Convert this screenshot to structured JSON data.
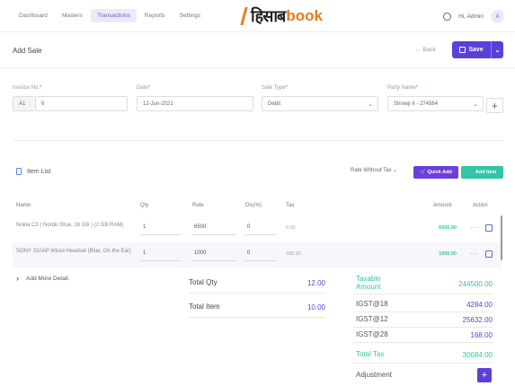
{
  "nav": {
    "items": [
      {
        "label": "Dashboard"
      },
      {
        "label": "Masters"
      },
      {
        "label": "Transactions"
      },
      {
        "label": "Reports"
      },
      {
        "label": "Settings"
      }
    ],
    "active_index": 2
  },
  "logo": {
    "hindi": "हिसाब",
    "book": "book"
  },
  "user": {
    "greeting": "Hi,",
    "name": "Admin",
    "initial": "A"
  },
  "page": {
    "title": "Add Sale",
    "back_label": "Back",
    "save_label": "Save"
  },
  "form": {
    "invoice": {
      "label": "Invoice No.",
      "prefix": "A1",
      "number": "6"
    },
    "date": {
      "label": "Date",
      "value": "12-Jun-2021"
    },
    "sale_type": {
      "label": "Sale Type",
      "value": "Debit"
    },
    "party": {
      "label": "Party Name",
      "value": "Shreeji II - 274564"
    }
  },
  "items": {
    "title": "Item List",
    "rate_mode": "Rate Without Tax",
    "quick_add_label": "Quick Add",
    "add_item_label": "Add Item",
    "columns": [
      "Name",
      "Qty",
      "Rate",
      "Dis(%)",
      "Tax",
      "Amount",
      "Action"
    ],
    "rows": [
      {
        "name": "Nokia C3 ( Nordic Blue, 16 GB ) (2 GB RAM)",
        "qty": "1",
        "rate": "6500",
        "dis": "0",
        "tax": "0.00",
        "amount": "6500.00"
      },
      {
        "name": "SONY 310AP Wired Headset (Blue, On the Ear)",
        "qty": "1",
        "rate": "1000",
        "dis": "0",
        "tax": "180.00",
        "amount": "1000.00"
      }
    ]
  },
  "more_label": "Add More Detail.",
  "totals_mid": {
    "qty_label": "Total Qty",
    "qty_value": "12.00",
    "item_label": "Total Item",
    "item_value": "10.00"
  },
  "summary": {
    "taxable_label": "Taxable Amount",
    "taxable_value": "244500.00",
    "igst18_label": "IGST@18",
    "igst18_value": "4284.00",
    "igst12_label": "IGST@12",
    "igst12_value": "25632.00",
    "igst28_label": "IGST@28",
    "igst28_value": "168.00",
    "total_tax_label": "Total Tax",
    "total_tax_value": "30084.00",
    "adjustment_label": "Adjustment"
  },
  "colors": {
    "accent": "#5b3fd9",
    "teal": "#2fc6a6",
    "brand_orange": "#e87a1d"
  }
}
